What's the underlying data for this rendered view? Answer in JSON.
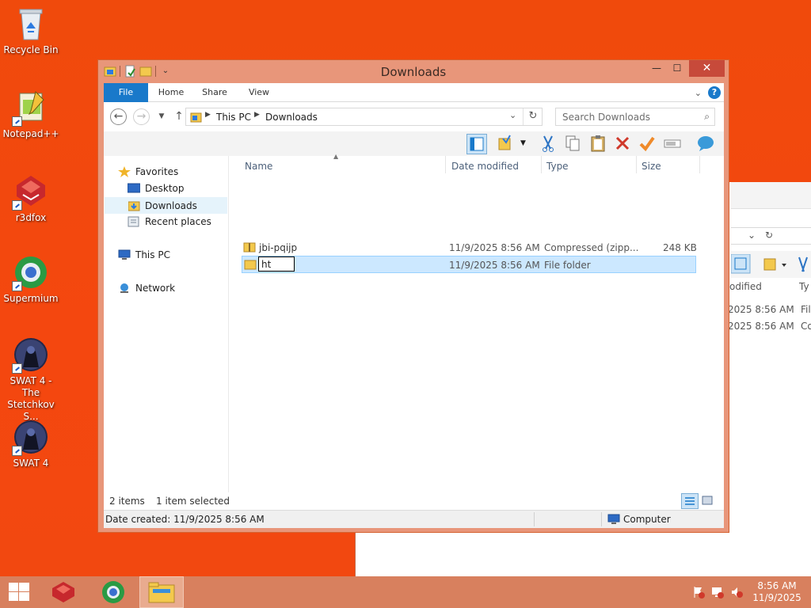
{
  "desktop": {
    "icons": [
      {
        "label": "Recycle Bin"
      },
      {
        "label": "Notepad++"
      },
      {
        "label": "r3dfox"
      },
      {
        "label": "Supermium"
      },
      {
        "label": "SWAT 4 - The Stetchkov S..."
      },
      {
        "label": "SWAT 4"
      }
    ]
  },
  "background_window": {
    "col_modified": "odified",
    "col_type": "Ty",
    "rows": [
      {
        "modified": "2025 8:56 AM",
        "type": "Fil"
      },
      {
        "modified": "2025 8:56 AM",
        "type": "Co"
      }
    ]
  },
  "window": {
    "title": "Downloads",
    "ribbon_tabs": {
      "file": "File",
      "home": "Home",
      "share": "Share",
      "view": "View"
    },
    "address": {
      "crumbs": [
        "This PC",
        "Downloads"
      ]
    },
    "search": {
      "placeholder": "Search Downloads"
    },
    "nav": {
      "favorites": "Favorites",
      "desktop": "Desktop",
      "downloads": "Downloads",
      "recent": "Recent places",
      "this_pc": "This PC",
      "network": "Network"
    },
    "columns": {
      "name": "Name",
      "date": "Date modified",
      "type": "Type",
      "size": "Size"
    },
    "files": [
      {
        "name": "jbi-pqijp",
        "date": "11/9/2025 8:56 AM",
        "type": "Compressed (zipp...",
        "size": "248 KB"
      },
      {
        "name": "ht",
        "date": "11/9/2025 8:56 AM",
        "type": "File folder",
        "size": "",
        "renaming": true
      }
    ],
    "status": {
      "items": "2 items",
      "selected": "1 item selected"
    },
    "details": {
      "created": "Date created: 11/9/2025 8:56 AM",
      "location": "Computer"
    }
  },
  "taskbar": {
    "time": "8:56 AM",
    "date": "11/9/2025"
  },
  "colors": {
    "accent": "#1979ca",
    "desktop": "#f24810",
    "taskbar": "#d8805e",
    "title_frame": "#e8967a"
  }
}
